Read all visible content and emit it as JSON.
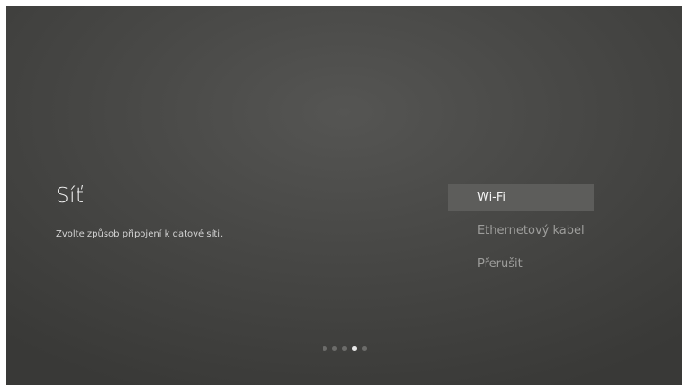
{
  "page": {
    "title": "Síť",
    "subtitle": "Zvolte způsob připojení k datové síti."
  },
  "menu": {
    "items": [
      {
        "label": "Wi-Fi",
        "selected": true
      },
      {
        "label": "Ethernetový kabel",
        "selected": false
      },
      {
        "label": "Přerušit",
        "selected": false
      }
    ]
  },
  "progress": {
    "total_steps": 5,
    "current_step": 4
  },
  "colors": {
    "background": "#484846",
    "selected_item_bg": "#5d5d5b",
    "text_primary": "#f2f2f2",
    "text_muted": "#9d9d9b"
  }
}
